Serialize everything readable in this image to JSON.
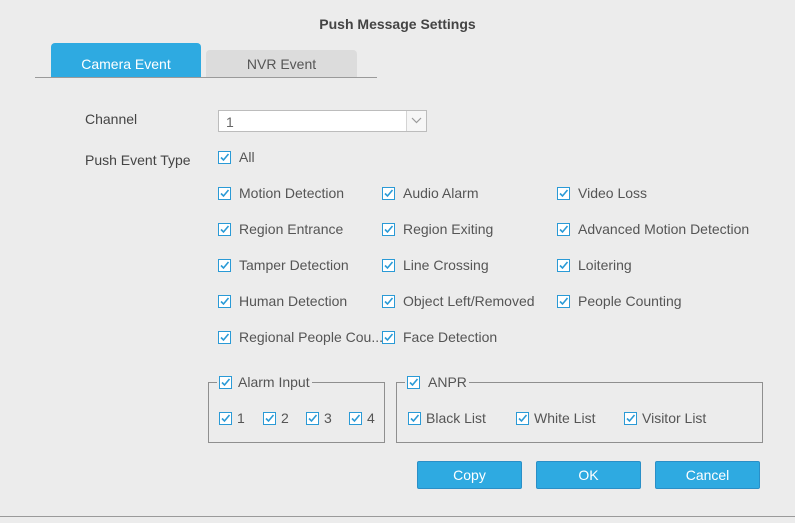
{
  "dialog": {
    "title": "Push Message Settings"
  },
  "tabs": [
    {
      "label": "Camera Event",
      "active": true
    },
    {
      "label": "NVR Event",
      "active": false
    }
  ],
  "channel": {
    "label": "Channel",
    "value": "1"
  },
  "push_event_type": {
    "label": "Push Event Type",
    "all": {
      "label": "All",
      "checked": true
    },
    "events": [
      {
        "label": "Motion Detection",
        "checked": true
      },
      {
        "label": "Audio Alarm",
        "checked": true
      },
      {
        "label": "Video Loss",
        "checked": true
      },
      {
        "label": "Region Entrance",
        "checked": true
      },
      {
        "label": "Region Exiting",
        "checked": true
      },
      {
        "label": "Advanced Motion Detection",
        "checked": true
      },
      {
        "label": "Tamper Detection",
        "checked": true
      },
      {
        "label": "Line Crossing",
        "checked": true
      },
      {
        "label": "Loitering",
        "checked": true
      },
      {
        "label": "Human Detection",
        "checked": true
      },
      {
        "label": "Object Left/Removed",
        "checked": true
      },
      {
        "label": "People Counting",
        "checked": true
      },
      {
        "label": "Regional People Cou...",
        "checked": true
      },
      {
        "label": "Face Detection",
        "checked": true
      }
    ]
  },
  "alarm_input": {
    "label": "Alarm Input",
    "checked": true,
    "items": [
      {
        "label": "1",
        "checked": true
      },
      {
        "label": "2",
        "checked": true
      },
      {
        "label": "3",
        "checked": true
      },
      {
        "label": "4",
        "checked": true
      }
    ]
  },
  "anpr": {
    "label": "ANPR",
    "checked": true,
    "items": [
      {
        "label": "Black List",
        "checked": true
      },
      {
        "label": "White List",
        "checked": true
      },
      {
        "label": "Visitor List",
        "checked": true
      }
    ]
  },
  "buttons": {
    "copy": "Copy",
    "ok": "OK",
    "cancel": "Cancel"
  },
  "colors": {
    "accent": "#2eaae1",
    "check": "#2a9ad6",
    "background": "#ececec"
  }
}
